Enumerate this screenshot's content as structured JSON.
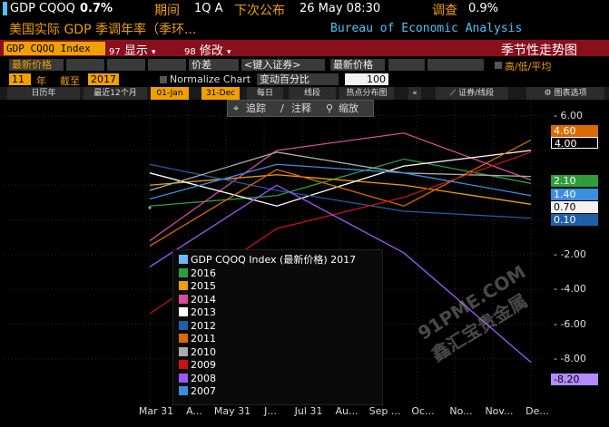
{
  "header": {
    "ticker": "GDP CQOQ",
    "value": "0.7%",
    "period_label": "期间",
    "period_value": "1Q A",
    "next_release_label": "下次公布",
    "next_release_value": "26 May 08:30",
    "survey_label": "调查",
    "survey_value": "0.9%",
    "description": "美国实际 GDP 季调年率（季环...",
    "source": "Bureau of Economic Analysis"
  },
  "toolbar": {
    "security": "GDP CQOQ Index",
    "display_menu": "显示",
    "edit_menu": "修改",
    "display_num": "97",
    "edit_num": "98",
    "title": "季节性走势图"
  },
  "controls": {
    "price_field": "最新价格",
    "mode": "价差",
    "security_input": "<键入证券>",
    "price_field_2": "最新价格",
    "high_low_avg": "高/低/平均",
    "years": "11",
    "years_label": "年",
    "as_of_label": "截至",
    "as_of_year": "2017",
    "normalize": "Normalize Chart",
    "change_pct": "变动百分比",
    "change_value": "100"
  },
  "tabs": {
    "calendar_year": "日历年",
    "last_12m": "最近12个月",
    "start": "01-Jan",
    "end": "31-Dec",
    "daily": "每日",
    "line": "线段",
    "heatmap": "热点分布图",
    "collapse": "«",
    "security_line": "证券/线段",
    "chart_options": "图表选项"
  },
  "chart_tools": {
    "track": "追踪",
    "annotate": "注释",
    "zoom": "缩放"
  },
  "watermark": "91PME.COM 鑫汇宝贵金属",
  "y_ticks": [
    "6.00",
    "-2.00",
    "-4.00",
    "-6.00",
    "-8.00"
  ],
  "x_ticks": [
    "Mar 31",
    "A...",
    "May 31",
    "J...",
    "Jul 31",
    "Au...",
    "Sep ...",
    "Oc...",
    "No...",
    "Nov...",
    "De..."
  ],
  "value_tags": [
    "4.60",
    "4.00",
    "2.10",
    "1.40",
    "0.70",
    "0.10",
    "-8.20"
  ],
  "colors": {
    "amber": "#f0a000",
    "bar_red": "#8a0f1e",
    "accent_cyan": "#4fc3f7"
  },
  "chart_data": {
    "type": "line",
    "x": [
      "Mar 31",
      "Jun 30",
      "Sep 30",
      "Dec 31"
    ],
    "ylim": [
      -9,
      6.5
    ],
    "series": [
      {
        "name": "GDP CQOQ Index (最新价格) 2017",
        "color": "#6fb8ff",
        "values": [
          0.7,
          null,
          null,
          null
        ]
      },
      {
        "name": "2016",
        "color": "#2e9e3a",
        "values": [
          0.8,
          1.4,
          3.5,
          2.1
        ]
      },
      {
        "name": "2015",
        "color": "#f0a000",
        "values": [
          2.0,
          2.6,
          2.0,
          0.9
        ]
      },
      {
        "name": "2014",
        "color": "#d94b9b",
        "values": [
          -1.2,
          4.0,
          5.0,
          2.3
        ]
      },
      {
        "name": "2013",
        "color": "#ffffff",
        "values": [
          2.7,
          0.8,
          3.1,
          4.0
        ]
      },
      {
        "name": "2012",
        "color": "#1f5fa8",
        "values": [
          3.2,
          1.7,
          0.5,
          0.1
        ]
      },
      {
        "name": "2011",
        "color": "#d96a00",
        "values": [
          -1.5,
          2.9,
          0.8,
          4.6
        ]
      },
      {
        "name": "2010",
        "color": "#aaaaaa",
        "values": [
          1.7,
          3.9,
          2.7,
          2.5
        ]
      },
      {
        "name": "2009",
        "color": "#cc1111",
        "values": [
          -5.4,
          -0.5,
          1.3,
          3.9
        ]
      },
      {
        "name": "2008",
        "color": "#9b59ff",
        "values": [
          -2.7,
          2.0,
          -1.9,
          -8.2
        ]
      },
      {
        "name": "2007",
        "color": "#3c8ee0",
        "values": [
          1.2,
          3.2,
          2.7,
          1.4
        ]
      }
    ]
  }
}
